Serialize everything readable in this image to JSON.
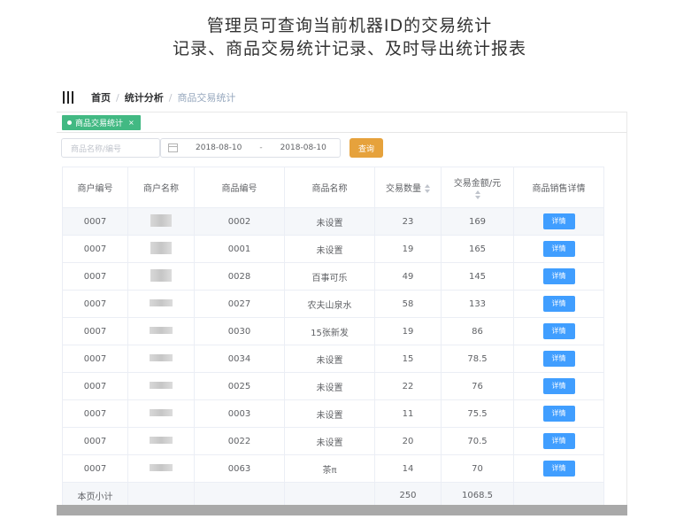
{
  "caption": {
    "line1": "管理员可查询当前机器ID的交易统计",
    "line2": "记录、商品交易统计记录、及时导出统计报表"
  },
  "breadcrumb": {
    "home": "首页",
    "section": "统计分析",
    "current": "商品交易统计"
  },
  "tab": {
    "label": "商品交易统计",
    "close": "×"
  },
  "filters": {
    "name_placeholder": "商品名称/编号",
    "date_start": "2018-08-10",
    "date_sep": "-",
    "date_end": "2018-08-10",
    "search_label": "查询"
  },
  "table": {
    "headers": [
      "商户编号",
      "商户名称",
      "商品编号",
      "商品名称",
      "交易数量",
      "交易金额/元",
      "商品销售详情"
    ],
    "detail_label": "详情",
    "rows": [
      {
        "merchant_no": "0007",
        "product_no": "0002",
        "product_name": "未设置",
        "qty": "23",
        "amount": "169"
      },
      {
        "merchant_no": "0007",
        "product_no": "0001",
        "product_name": "未设置",
        "qty": "19",
        "amount": "165"
      },
      {
        "merchant_no": "0007",
        "product_no": "0028",
        "product_name": "百事可乐",
        "qty": "49",
        "amount": "145"
      },
      {
        "merchant_no": "0007",
        "product_no": "0027",
        "product_name": "农夫山泉水",
        "qty": "58",
        "amount": "133"
      },
      {
        "merchant_no": "0007",
        "product_no": "0030",
        "product_name": "15张新发",
        "qty": "19",
        "amount": "86"
      },
      {
        "merchant_no": "0007",
        "product_no": "0034",
        "product_name": "未设置",
        "qty": "15",
        "amount": "78.5"
      },
      {
        "merchant_no": "0007",
        "product_no": "0025",
        "product_name": "未设置",
        "qty": "22",
        "amount": "76"
      },
      {
        "merchant_no": "0007",
        "product_no": "0003",
        "product_name": "未设置",
        "qty": "11",
        "amount": "75.5"
      },
      {
        "merchant_no": "0007",
        "product_no": "0022",
        "product_name": "未设置",
        "qty": "20",
        "amount": "70.5"
      },
      {
        "merchant_no": "0007",
        "product_no": "0063",
        "product_name": "茶π",
        "qty": "14",
        "amount": "70"
      }
    ],
    "summary": {
      "label": "本页小计",
      "qty": "250",
      "amount": "1068.5"
    }
  },
  "colors": {
    "tag": "#42b983",
    "search_button": "#e6a23c",
    "detail_button": "#409eff"
  },
  "icons": {
    "menu": "hamburger-icon",
    "calendar": "calendar-icon",
    "sort": "sort-icon",
    "tag_dot": "dot-icon",
    "tag_close": "close-icon"
  }
}
